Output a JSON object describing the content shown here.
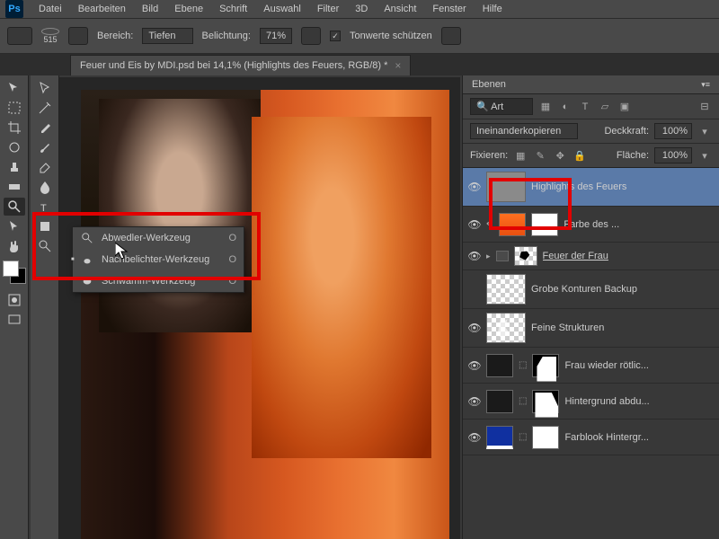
{
  "menu": [
    "Datei",
    "Bearbeiten",
    "Bild",
    "Ebene",
    "Schrift",
    "Auswahl",
    "Filter",
    "3D",
    "Ansicht",
    "Fenster",
    "Hilfe"
  ],
  "optionsBar": {
    "brushSize": "515",
    "rangeLabel": "Bereich:",
    "rangeValue": "Tiefen",
    "exposureLabel": "Belichtung:",
    "exposureValue": "71%",
    "protectLabel": "Tonwerte schützen"
  },
  "docTab": "Feuer und Eis by MDI.psd bei 14,1% (Highlights des Feuers, RGB/8) *",
  "flyout": [
    {
      "label": "Abwedler-Werkzeug",
      "key": "O"
    },
    {
      "label": "Nachbelichter-Werkzeug",
      "key": "O"
    },
    {
      "label": "Schwamm-Werkzeug",
      "key": "O"
    }
  ],
  "layersPanel": {
    "title": "Ebenen",
    "searchPlaceholder": "Art",
    "blendMode": "Ineinanderkopieren",
    "opacityLabel": "Deckkraft:",
    "opacityValue": "100%",
    "lockLabel": "Fixieren:",
    "fillLabel": "Fläche:",
    "fillValue": "100%"
  },
  "layers": [
    {
      "name": "Highlights des Feuers",
      "selected": true,
      "thumb": "gray",
      "vis": true
    },
    {
      "name": "Farbe des ...",
      "thumb": "orange",
      "mask": "white",
      "vis": true,
      "linked": true
    },
    {
      "name": "Feuer der Frau",
      "thumb": "folder",
      "vis": true,
      "underline": true,
      "group": true
    },
    {
      "name": "Grobe Konturen Backup",
      "thumb": "chk",
      "vis": false
    },
    {
      "name": "Feine Strukturen",
      "thumb": "chk",
      "vis": true
    },
    {
      "name": "Frau wieder rötlic...",
      "thumb": "dark",
      "mask": "mask1",
      "vis": true,
      "linked": true
    },
    {
      "name": "Hintergrund abdu...",
      "thumb": "dark",
      "mask": "mask2",
      "vis": true,
      "linked": true
    },
    {
      "name": "Farblook Hintergr...",
      "thumb": "blue",
      "mask": "white",
      "vis": true,
      "linked": true
    }
  ]
}
